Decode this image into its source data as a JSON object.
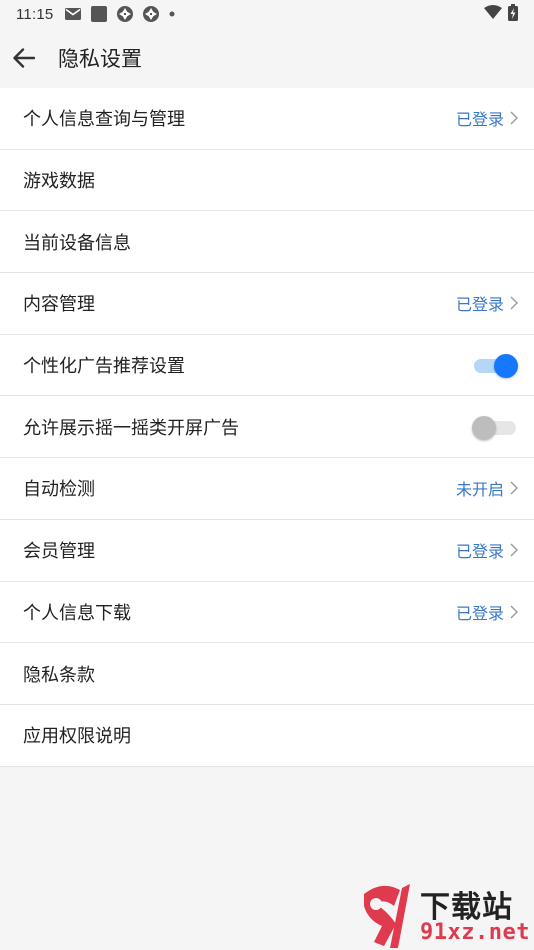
{
  "status_bar": {
    "time": "11:15",
    "left_icons": [
      "mail-icon",
      "square-app-icon",
      "shutter-icon",
      "shutter-icon",
      "dot-icon"
    ],
    "right_icons": [
      "wifi-icon",
      "battery-charging-icon"
    ]
  },
  "app_bar": {
    "title": "隐私设置"
  },
  "colors": {
    "accent": "#1677ff",
    "status_text": "#3a78c6",
    "background": "#f5f5f5"
  },
  "items": [
    {
      "label": "个人信息查询与管理",
      "status": "已登录"
    },
    {
      "label": "游戏数据"
    },
    {
      "label": "当前设备信息"
    },
    {
      "label": "内容管理",
      "status": "已登录"
    },
    {
      "label": "个性化广告推荐设置",
      "toggle": "on"
    },
    {
      "label": "允许展示摇一摇类开屏广告",
      "toggle": "off"
    },
    {
      "label": "自动检测",
      "status": "未开启"
    },
    {
      "label": "会员管理",
      "status": "已登录"
    },
    {
      "label": "个人信息下载",
      "status": "已登录"
    },
    {
      "label": "隐私条款"
    },
    {
      "label": "应用权限说明"
    }
  ],
  "watermark": {
    "logo_text": "下载站",
    "domain": "91xz.net"
  }
}
